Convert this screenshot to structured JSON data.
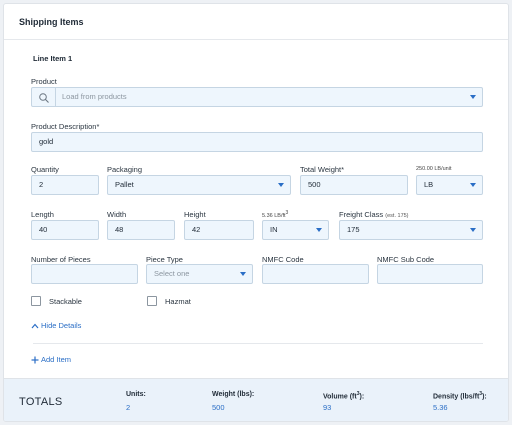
{
  "header": {
    "title": "Shipping Items"
  },
  "line_item": {
    "title": "Line Item 1",
    "product": {
      "label": "Product",
      "placeholder": "Load from products",
      "icon": "search-icon"
    },
    "description": {
      "label": "Product Description*",
      "value": "gold"
    },
    "quantity": {
      "label": "Quantity",
      "value": "2"
    },
    "packaging": {
      "label": "Packaging",
      "value": "Pallet"
    },
    "total_weight": {
      "label": "Total Weight*",
      "value": "500",
      "per_unit_note": "250.00 LB/unit"
    },
    "weight_unit": {
      "value": "LB"
    },
    "length": {
      "label": "Length",
      "value": "40"
    },
    "width": {
      "label": "Width",
      "value": "48"
    },
    "height": {
      "label": "Height",
      "value": "42"
    },
    "density_note": {
      "prefix": "5.36 LB/ft",
      "sup": "3"
    },
    "dim_unit": {
      "value": "IN"
    },
    "freight_class": {
      "label": "Freight Class",
      "note": "(est. 175)",
      "value": "175"
    },
    "pieces": {
      "label": "Number of Pieces",
      "value": ""
    },
    "piece_type": {
      "label": "Piece Type",
      "placeholder": "Select one"
    },
    "nmfc_code": {
      "label": "NMFC Code",
      "value": ""
    },
    "nmfc_sub_code": {
      "label": "NMFC Sub Code",
      "value": ""
    },
    "stackable": {
      "label": "Stackable",
      "checked": false
    },
    "hazmat": {
      "label": "Hazmat",
      "checked": false
    },
    "hide_details": "Hide Details"
  },
  "add_item": "Add Item",
  "totals": {
    "title": "TOTALS",
    "units": {
      "label": "Units:",
      "value": "2"
    },
    "weight": {
      "label": "Weight (lbs):",
      "value": "500"
    },
    "volume": {
      "label_prefix": "Volume (ft",
      "label_sup": "3",
      "label_suffix": "):",
      "value": "93"
    },
    "density": {
      "label_prefix": "Density (lbs/ft",
      "label_sup": "3",
      "label_suffix": "):",
      "value": "5.36"
    }
  },
  "colors": {
    "accent": "#2a6ec6",
    "field_bg": "#eef6fd",
    "totals_bg": "#eaf2fa"
  }
}
